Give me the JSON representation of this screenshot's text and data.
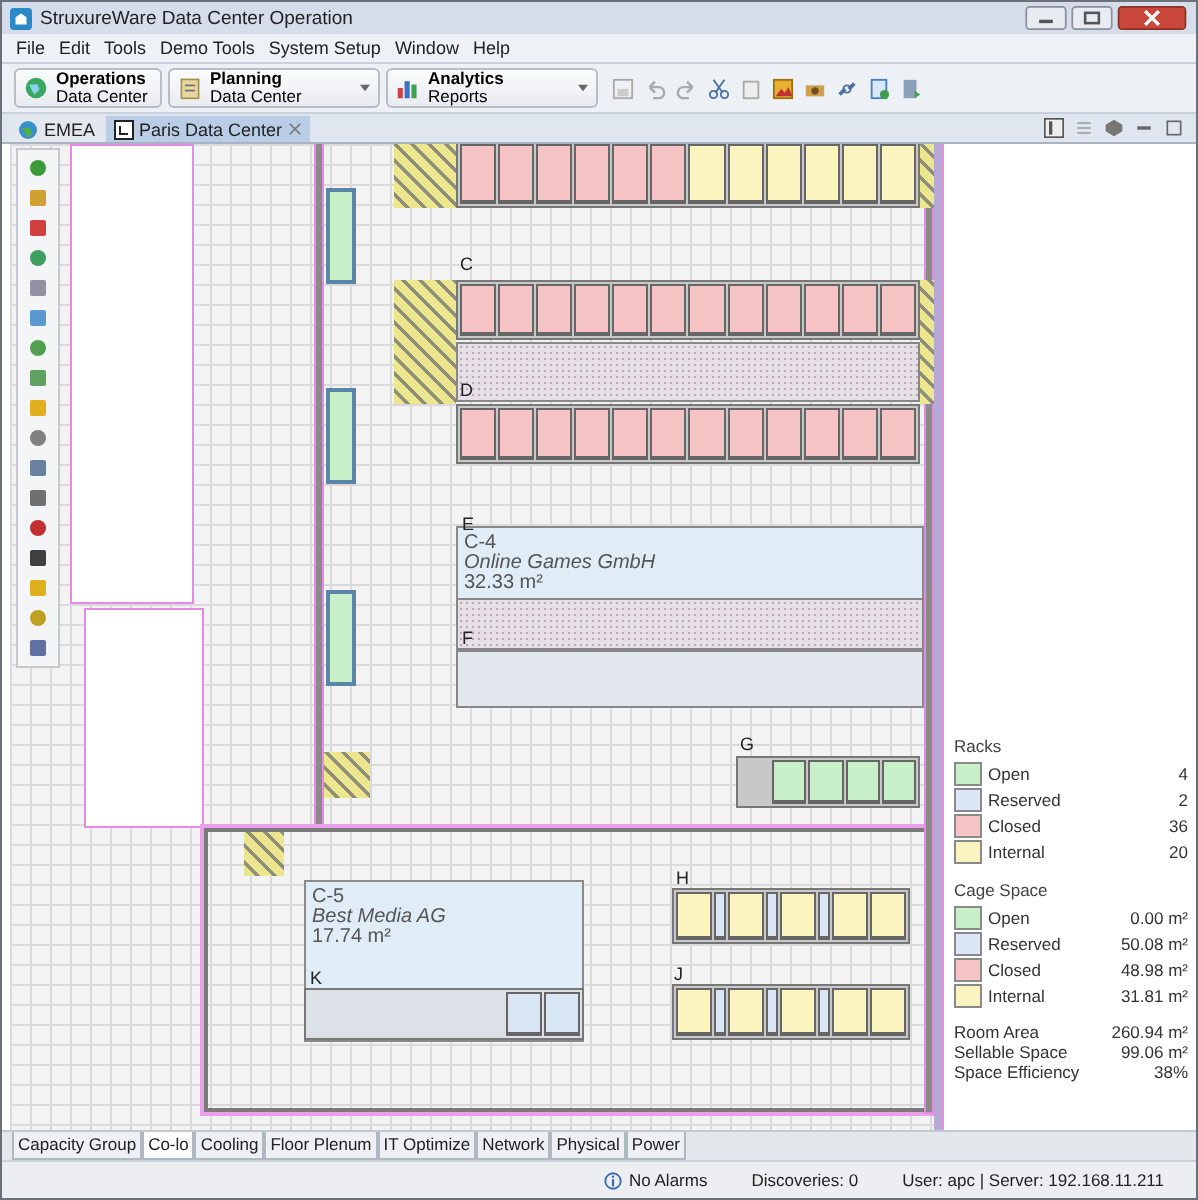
{
  "window": {
    "title": "StruxureWare Data Center Operation"
  },
  "menu": [
    "File",
    "Edit",
    "Tools",
    "Demo Tools",
    "System Setup",
    "Window",
    "Help"
  ],
  "perspectives": [
    {
      "title": "Operations",
      "subtitle": "Data Center",
      "dropdown": false
    },
    {
      "title": "Planning",
      "subtitle": "Data Center",
      "dropdown": true
    },
    {
      "title": "Analytics",
      "subtitle": "Reports",
      "dropdown": true
    }
  ],
  "tabs": [
    {
      "label": "EMEA",
      "selected": false,
      "closable": false
    },
    {
      "label": "Paris Data Center",
      "selected": true,
      "closable": true
    }
  ],
  "floor": {
    "wall_racks": [
      {
        "color": "#c8f0c8"
      },
      {
        "color": "#c8f0c8"
      },
      {
        "color": "#c8f0c8"
      }
    ],
    "rows": [
      {
        "kind": "racks",
        "racks": [
          {
            "color": "#f6c4c4",
            "kind": "rack"
          },
          {
            "color": "#f6c4c4",
            "kind": "rack"
          },
          {
            "color": "#f6c4c4",
            "kind": "rack"
          },
          {
            "color": "#f6c4c4",
            "kind": "rack"
          },
          {
            "color": "#f6c4c4",
            "kind": "rack"
          },
          {
            "color": "#f6c4c4",
            "kind": "rack"
          },
          {
            "color": "#fbf4bf",
            "kind": "rack"
          },
          {
            "color": "#fbf4bf",
            "kind": "rack"
          },
          {
            "color": "#fbf4bf",
            "kind": "rack"
          },
          {
            "color": "#fbf4bf",
            "kind": "rack"
          },
          {
            "color": "#fbf4bf",
            "kind": "rack"
          },
          {
            "color": "#fbf4bf",
            "kind": "rack"
          }
        ]
      },
      {
        "label": "C",
        "kind": "racks",
        "racks": [
          {
            "color": "#f6c4c4",
            "kind": "rack"
          },
          {
            "color": "#f6c4c4",
            "kind": "rack"
          },
          {
            "color": "#f6c4c4",
            "kind": "rack"
          },
          {
            "color": "#f6c4c4",
            "kind": "rack"
          },
          {
            "color": "#f6c4c4",
            "kind": "rack"
          },
          {
            "color": "#f6c4c4",
            "kind": "rack"
          },
          {
            "color": "#f6c4c4",
            "kind": "rack"
          },
          {
            "color": "#f6c4c4",
            "kind": "rack"
          },
          {
            "color": "#f6c4c4",
            "kind": "rack"
          },
          {
            "color": "#f6c4c4",
            "kind": "rack"
          },
          {
            "color": "#f6c4c4",
            "kind": "rack"
          },
          {
            "color": "#f6c4c4",
            "kind": "rack"
          }
        ]
      },
      {
        "label": "D",
        "kind": "racks",
        "racks": [
          {
            "color": "#f6c4c4",
            "kind": "rack"
          },
          {
            "color": "#f6c4c4",
            "kind": "rack"
          },
          {
            "color": "#f6c4c4",
            "kind": "rack"
          },
          {
            "color": "#f6c4c4",
            "kind": "rack"
          },
          {
            "color": "#f6c4c4",
            "kind": "rack"
          },
          {
            "color": "#f6c4c4",
            "kind": "rack"
          },
          {
            "color": "#f6c4c4",
            "kind": "rack"
          },
          {
            "color": "#f6c4c4",
            "kind": "rack"
          },
          {
            "color": "#f6c4c4",
            "kind": "rack"
          },
          {
            "color": "#f6c4c4",
            "kind": "rack"
          },
          {
            "color": "#f6c4c4",
            "kind": "rack"
          },
          {
            "color": "#f6c4c4",
            "kind": "rack"
          }
        ]
      },
      {
        "label": "E",
        "kind": "tiles"
      },
      {
        "label": "F",
        "kind": "empty"
      },
      {
        "label": "G",
        "kind": "racks",
        "racks": [
          {
            "color": "#c8f0c8",
            "kind": "rack"
          },
          {
            "color": "#c8f0c8",
            "kind": "rack"
          },
          {
            "color": "#c8f0c8",
            "kind": "rack"
          },
          {
            "color": "#c8f0c8",
            "kind": "rack"
          }
        ]
      },
      {
        "label": "H",
        "kind": "racks",
        "racks": [
          {
            "color": "#fbf4bf",
            "kind": "rack"
          },
          {
            "color": "#d8e6f6",
            "kind": "narrow"
          },
          {
            "color": "#fbf4bf",
            "kind": "rack"
          },
          {
            "color": "#d8e6f6",
            "kind": "narrow"
          },
          {
            "color": "#fbf4bf",
            "kind": "rack"
          },
          {
            "color": "#d8e6f6",
            "kind": "narrow"
          },
          {
            "color": "#fbf4bf",
            "kind": "rack"
          },
          {
            "color": "#fbf4bf",
            "kind": "rack"
          }
        ]
      },
      {
        "label": "J",
        "kind": "racks",
        "racks": [
          {
            "color": "#fbf4bf",
            "kind": "rack"
          },
          {
            "color": "#d8e6f6",
            "kind": "narrow"
          },
          {
            "color": "#fbf4bf",
            "kind": "rack"
          },
          {
            "color": "#d8e6f6",
            "kind": "narrow"
          },
          {
            "color": "#fbf4bf",
            "kind": "rack"
          },
          {
            "color": "#d8e6f6",
            "kind": "narrow"
          },
          {
            "color": "#fbf4bf",
            "kind": "rack"
          },
          {
            "color": "#fbf4bf",
            "kind": "rack"
          }
        ]
      },
      {
        "label": "K",
        "kind": "racks",
        "racks": [
          {
            "color": "#d8e6f6",
            "kind": "rack"
          },
          {
            "color": "#d8e6f6",
            "kind": "rack"
          }
        ]
      }
    ],
    "cages": [
      {
        "name": "C-4",
        "tenant": "Online Games GmbH",
        "area": "32.33 m²"
      },
      {
        "name": "C-5",
        "tenant": "Best Media AG",
        "area": "17.74 m²"
      }
    ]
  },
  "legend": {
    "racks_title": "Racks",
    "racks": [
      {
        "label": "Open",
        "value": "4",
        "color": "#c8f0c8"
      },
      {
        "label": "Reserved",
        "value": "2",
        "color": "#d8e6f6"
      },
      {
        "label": "Closed",
        "value": "36",
        "color": "#f6c4c4"
      },
      {
        "label": "Internal",
        "value": "20",
        "color": "#fbf4bf"
      }
    ],
    "cage_title": "Cage Space",
    "cages": [
      {
        "label": "Open",
        "value": "0.00 m²",
        "color": "#c8f0c8"
      },
      {
        "label": "Reserved",
        "value": "50.08 m²",
        "color": "#d8e6f6"
      },
      {
        "label": "Closed",
        "value": "48.98 m²",
        "color": "#f6c4c4"
      },
      {
        "label": "Internal",
        "value": "31.81 m²",
        "color": "#fbf4bf"
      }
    ],
    "summary": [
      {
        "label": "Room Area",
        "value": "260.94 m²"
      },
      {
        "label": "Sellable Space",
        "value": "99.06 m²"
      },
      {
        "label": "Space Efficiency",
        "value": "38%"
      }
    ]
  },
  "bottom_tabs": [
    {
      "label": "Capacity Group",
      "selected": false
    },
    {
      "label": "Co-lo",
      "selected": true
    },
    {
      "label": "Cooling",
      "selected": false
    },
    {
      "label": "Floor Plenum",
      "selected": false
    },
    {
      "label": "IT Optimize",
      "selected": false
    },
    {
      "label": "Network",
      "selected": false
    },
    {
      "label": "Physical",
      "selected": false
    },
    {
      "label": "Power",
      "selected": false
    }
  ],
  "status": {
    "alarms": "No Alarms",
    "discoveries": "Discoveries: 0",
    "user": "User: apc | Server: 192.168.11.211"
  }
}
